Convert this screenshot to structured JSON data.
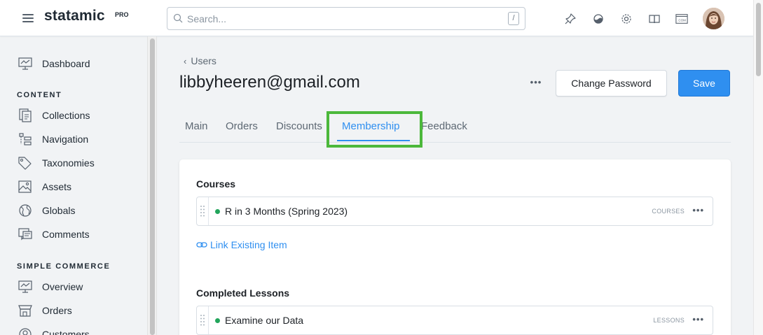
{
  "header": {
    "brand": "statamic",
    "edition": "PRO",
    "search": {
      "placeholder": "Search...",
      "value": "",
      "shortcut": "/"
    },
    "icons": [
      "pin-icon",
      "appearance-icon",
      "settings-icon",
      "docs-icon",
      "site-icon"
    ]
  },
  "sidebar": {
    "top": [
      {
        "label": "Dashboard",
        "icon": "dashboard-icon"
      }
    ],
    "sections": [
      {
        "heading": "CONTENT",
        "items": [
          {
            "label": "Collections",
            "icon": "collections-icon"
          },
          {
            "label": "Navigation",
            "icon": "navigation-icon"
          },
          {
            "label": "Taxonomies",
            "icon": "taxonomies-icon"
          },
          {
            "label": "Assets",
            "icon": "assets-icon"
          },
          {
            "label": "Globals",
            "icon": "globals-icon"
          },
          {
            "label": "Comments",
            "icon": "comments-icon"
          }
        ]
      },
      {
        "heading": "SIMPLE COMMERCE",
        "items": [
          {
            "label": "Overview",
            "icon": "overview-icon"
          },
          {
            "label": "Orders",
            "icon": "orders-icon"
          },
          {
            "label": "Customers",
            "icon": "customers-icon"
          }
        ]
      }
    ]
  },
  "main": {
    "breadcrumb": {
      "chevron": "‹",
      "label": "Users"
    },
    "title": "libbyheeren@gmail.com",
    "more": "•••",
    "change_password_label": "Change Password",
    "save_label": "Save",
    "tabs": [
      {
        "label": "Main",
        "active": false
      },
      {
        "label": "Orders",
        "active": false
      },
      {
        "label": "Discounts",
        "active": false
      },
      {
        "label": "Membership",
        "active": true
      },
      {
        "label": "Feedback",
        "active": false
      }
    ],
    "fields": [
      {
        "label": "Courses",
        "items": [
          {
            "title": "R in 3 Months (Spring 2023)",
            "tag": "COURSES",
            "published": true
          }
        ],
        "link_label": "Link Existing Item"
      },
      {
        "label": "Completed Lessons",
        "items": [
          {
            "title": "Examine our Data",
            "tag": "LESSONS",
            "published": true
          }
        ]
      }
    ]
  },
  "colors": {
    "accent": "#2f8ff0",
    "highlight": "#4cb83b",
    "published": "#22a55b",
    "background": "#f1f3f5"
  }
}
